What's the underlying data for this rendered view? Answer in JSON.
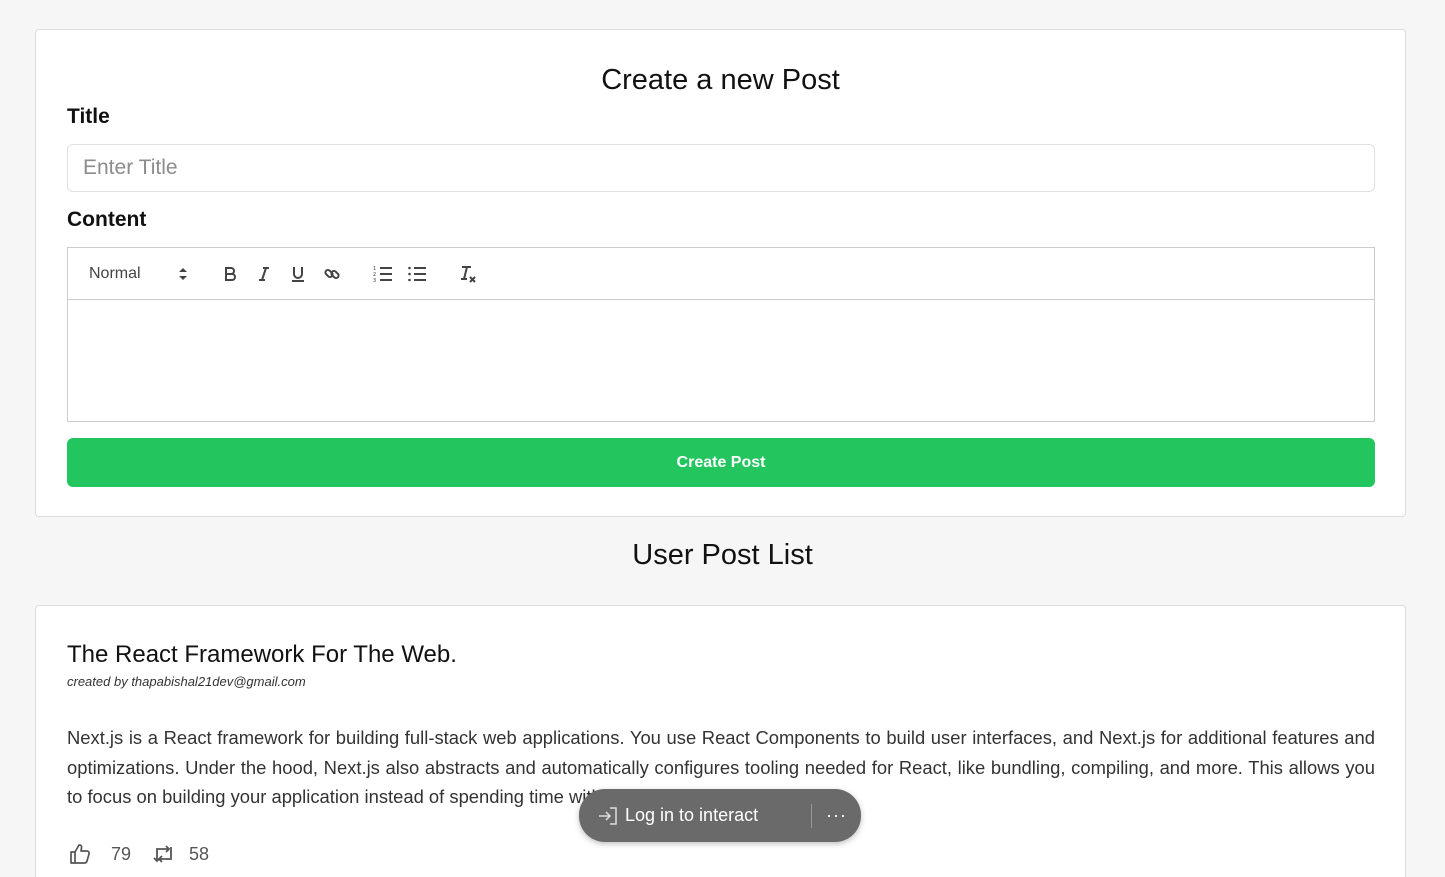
{
  "create_post": {
    "heading": "Create a new Post",
    "title_label": "Title",
    "title_placeholder": "Enter Title",
    "title_value": "",
    "content_label": "Content",
    "toolbar": {
      "header_select": "Normal",
      "buttons": [
        "bold-icon",
        "italic-icon",
        "underline-icon",
        "link-icon",
        "ordered-list-icon",
        "bullet-list-icon",
        "clear-format-icon"
      ]
    },
    "submit_label": "Create Post",
    "submit_color": "#22c55e"
  },
  "post_list": {
    "heading": "User Post List",
    "posts": [
      {
        "title": "The React Framework For The Web.",
        "author": "created by thapabishal21dev@gmail.com",
        "content": "Next.js is a React framework for building full-stack web applications. You use React Components to build user interfaces, and Next.js for additional features and optimizations. Under the hood, Next.js also abstracts and automatically configures tooling needed for React, like bundling, compiling, and more. This allows you to focus on building your application instead of spending time with configuration.",
        "likes": "79",
        "reposts": "58"
      }
    ]
  },
  "overlay": {
    "login_label": "Log in to interact",
    "more_label": "···"
  }
}
